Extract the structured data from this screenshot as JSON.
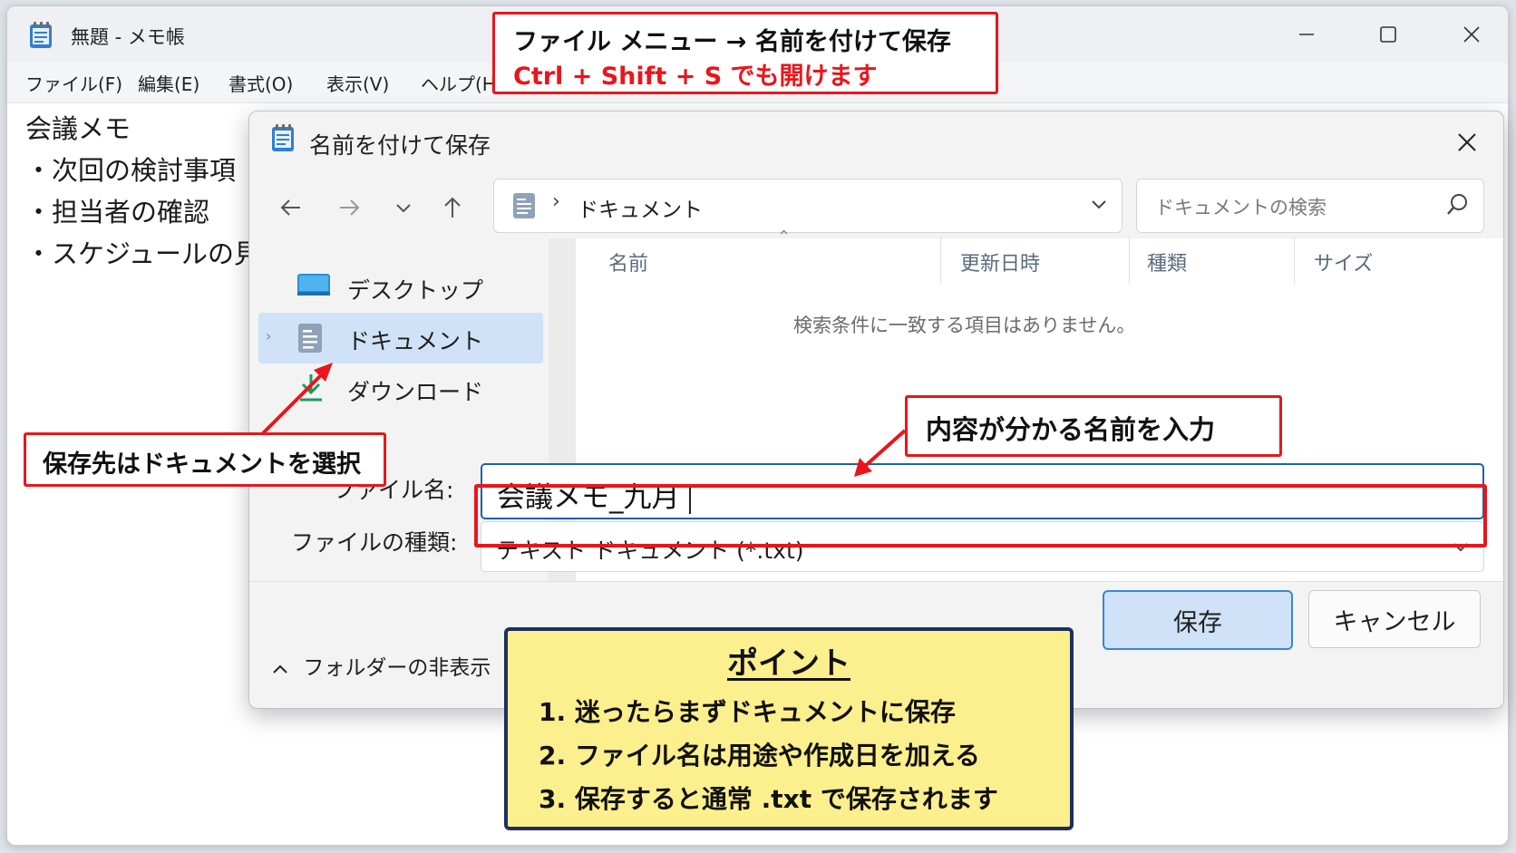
{
  "notepad": {
    "title": "無題 - メモ帳",
    "menu": [
      "ファイル(F)",
      "編集(E)",
      "書式(O)",
      "表示(V)",
      "ヘルプ(H"
    ],
    "lines": [
      "会議メモ",
      "・次回の検討事項",
      "・担当者の確認",
      "・スケジュールの見"
    ]
  },
  "dialog": {
    "title": "名前を付けて保存",
    "breadcrumb": "ドキュメント",
    "search_placeholder": "ドキュメントの検索",
    "nav_items": [
      {
        "label": "デスクトップ",
        "icon": "desktop-icon",
        "selected": false
      },
      {
        "label": "ドキュメント",
        "icon": "document-icon",
        "selected": true
      },
      {
        "label": "ダウンロード",
        "icon": "download-icon",
        "selected": false
      }
    ],
    "columns": [
      "名前",
      "更新日時",
      "種類",
      "サイズ"
    ],
    "empty_message": "検索条件に一致する項目はありません。",
    "filename_label": "ファイル名:",
    "filename_value": "会議メモ_九月",
    "filetype_label": "ファイルの種類:",
    "filetype_value": "テキスト ドキュメント (*.txt)",
    "hide_folders": "フォルダーの非表示",
    "save_button": "保存",
    "cancel_button": "キャンセル"
  },
  "annotations": {
    "top_line1": "ファイル メニュー → 名前を付けて保存",
    "top_line2": "Ctrl + Shift + S でも開けます",
    "left_callout": "保存先はドキュメントを選択",
    "right_callout": "内容が分かる名前を入力",
    "point_title": "ポイント",
    "point_items": [
      "1.  迷ったらまずドキュメントに保存",
      "2.  ファイル名は用途や作成日を加える",
      "3.  保存すると通常 .txt で保存されます"
    ]
  },
  "colors": {
    "callout_red": "#e8161b",
    "point_bg": "#fcef8d",
    "point_border": "#1d2f5e",
    "selection_blue": "#cfe2f7",
    "focus_blue": "#1d5fb8"
  }
}
